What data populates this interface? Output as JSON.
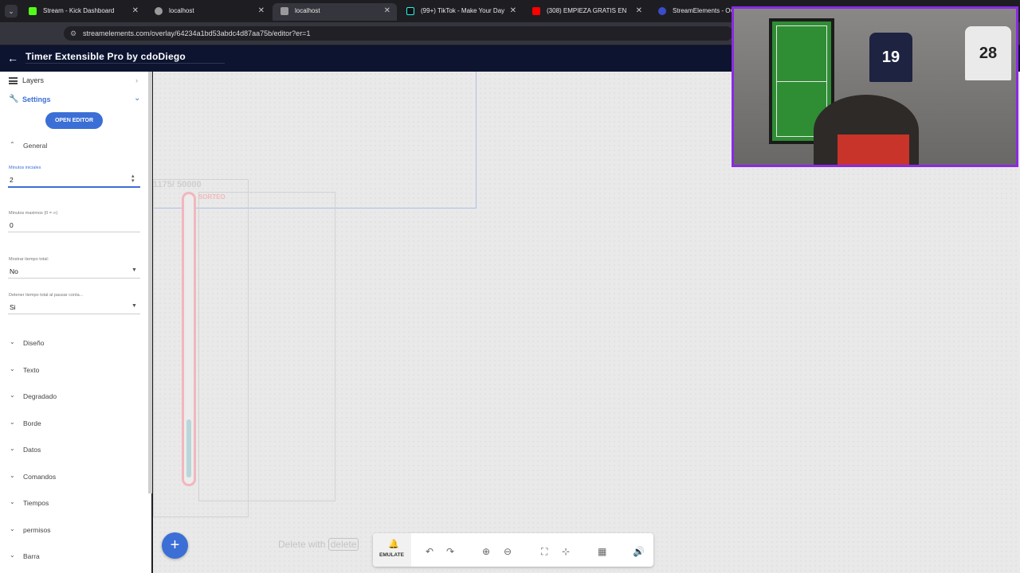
{
  "browser": {
    "tabs": [
      {
        "label": "Stream - Kick Dashboard",
        "fav_color": "#53fc18",
        "active": false
      },
      {
        "label": "localhost",
        "fav_color": "#9a9a9a",
        "active": false
      },
      {
        "label": "localhost",
        "fav_color": "#9a9a9a",
        "active": true
      },
      {
        "label": "(99+) TikTok - Make Your Day",
        "fav_color": "#111111",
        "active": false
      },
      {
        "label": "(308) EMPIEZA GRATIS EN",
        "fav_color": "#ff0000",
        "active": false
      },
      {
        "label": "StreamElements - Ove",
        "fav_color": "#3b4cca",
        "active": false
      }
    ],
    "url": "streamelements.com/overlay/64234a1bd53abdc4d87aa75b/editor?er=1"
  },
  "app": {
    "title": "Timer Extensible Pro by cdoDiego"
  },
  "sidebar": {
    "layers_label": "Layers",
    "settings_label": "Settings",
    "open_editor_label": "OPEN EDITOR",
    "general_label": "General",
    "fields": [
      {
        "label": "Minutos iniciales",
        "value": "2"
      },
      {
        "label": "Minutos maximos (0 = ∞)",
        "value": "0"
      },
      {
        "label": "Mostrar tiempo total:",
        "value": "No"
      },
      {
        "label": "Detener tiempo total al pausar conta...",
        "value": "Si"
      }
    ],
    "sections": [
      "Diseño",
      "Texto",
      "Degradado",
      "Borde",
      "Datos",
      "Comandos",
      "Tiempos",
      "permisos",
      "Barra"
    ]
  },
  "canvas": {
    "counter_text": "1175/ 50000",
    "sorteo_text": "SORTEO",
    "delete_hint": "Delete with",
    "delete_key": "delete",
    "progress": 0.2,
    "accent": "#3b6fd6"
  },
  "toolbar": {
    "emulate_label": "EMULATE"
  }
}
